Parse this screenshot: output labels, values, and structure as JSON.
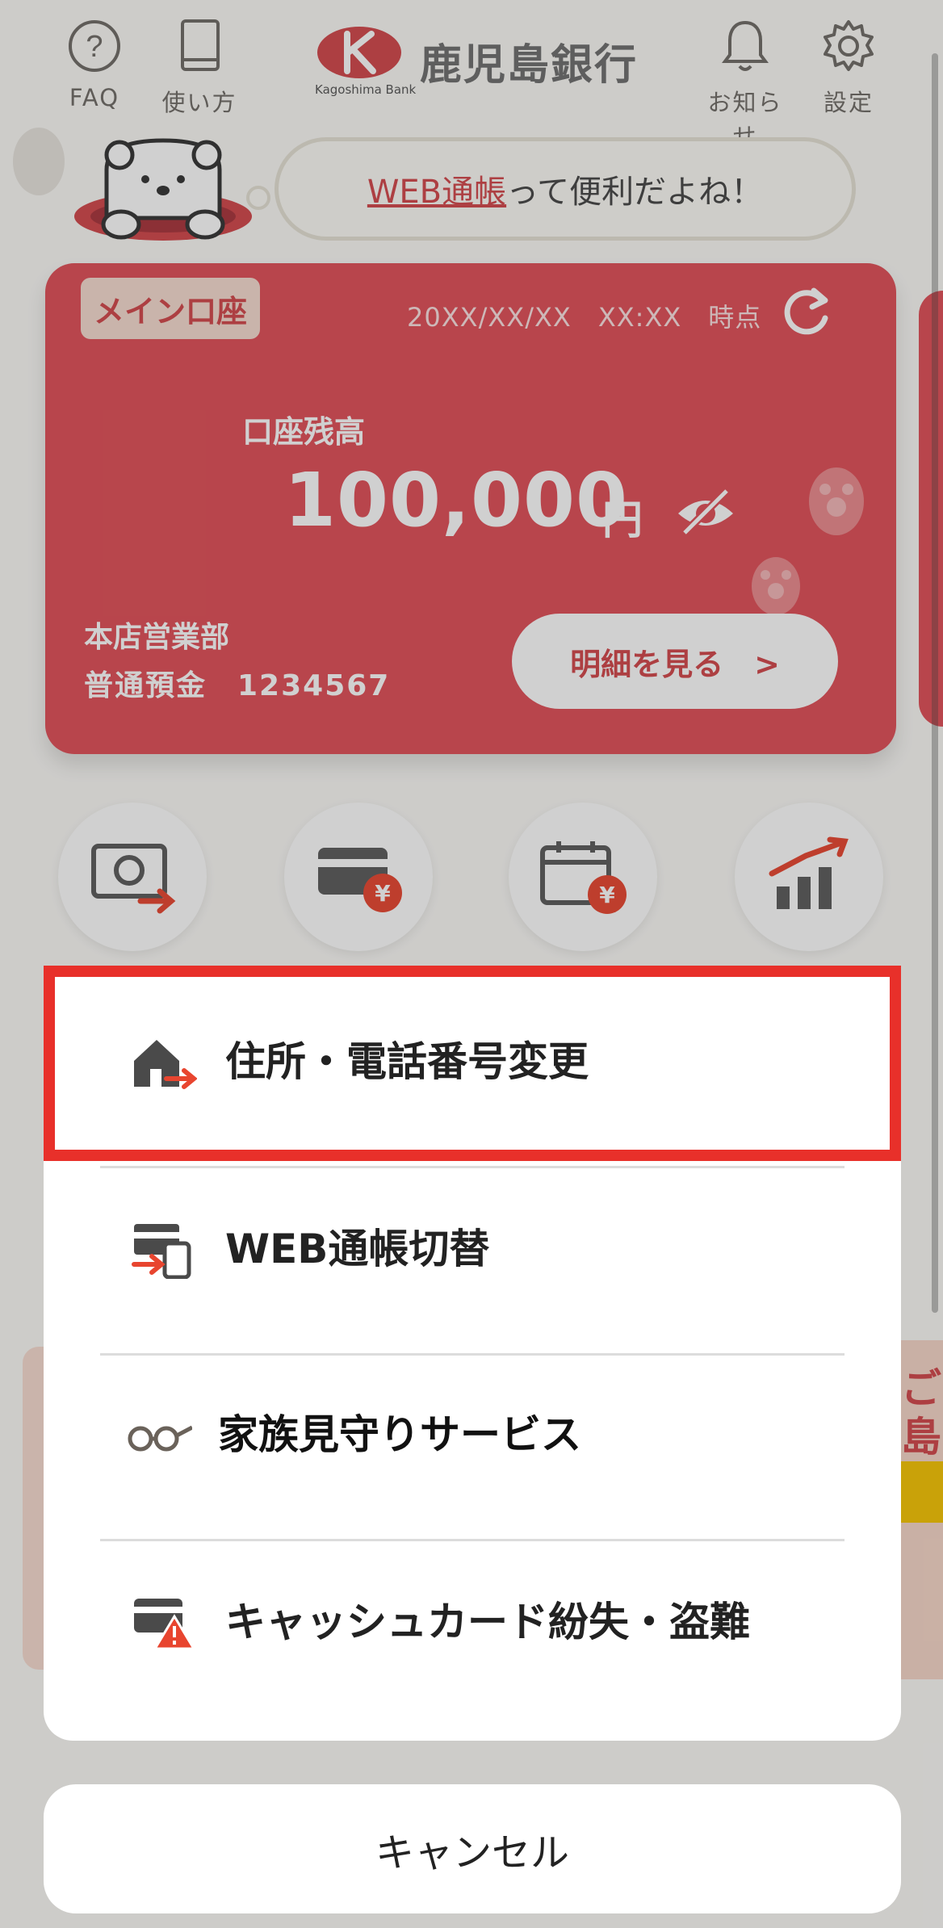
{
  "header": {
    "faq_label": "FAQ",
    "guide_label": "使い方",
    "bank_name": "鹿児島銀行",
    "bank_name_en": "Kagoshima Bank",
    "notice_label": "お知らせ",
    "settings_label": "設定"
  },
  "bubble": {
    "link_text": "WEB通帳",
    "rest_text": "って便利だよね！"
  },
  "account": {
    "badge": "メイン口座",
    "timestamp": "20XX/XX/XX　XX:XX　時点",
    "balance_label": "口座残高",
    "balance": "100,000",
    "unit": "円",
    "branch": "本店営業部",
    "account_line": "普通預金　1234567",
    "detail_button": "明細を見る　>"
  },
  "banner_right": {
    "line1": "ご",
    "line2": "島銀"
  },
  "sheet": {
    "items": [
      {
        "label": "住所・電話番号変更",
        "icon": "house-arrow-icon"
      },
      {
        "label": "WEB通帳切替",
        "icon": "device-switch-icon"
      },
      {
        "label": "家族見守りサービス",
        "icon": "glasses-icon"
      },
      {
        "label": "キャッシュカード紛失・盗難",
        "icon": "card-warning-icon"
      }
    ],
    "cancel": "キャンセル"
  },
  "colors": {
    "accent": "#e04e56",
    "highlight": "#e8302a",
    "warning": "#e8452f"
  }
}
